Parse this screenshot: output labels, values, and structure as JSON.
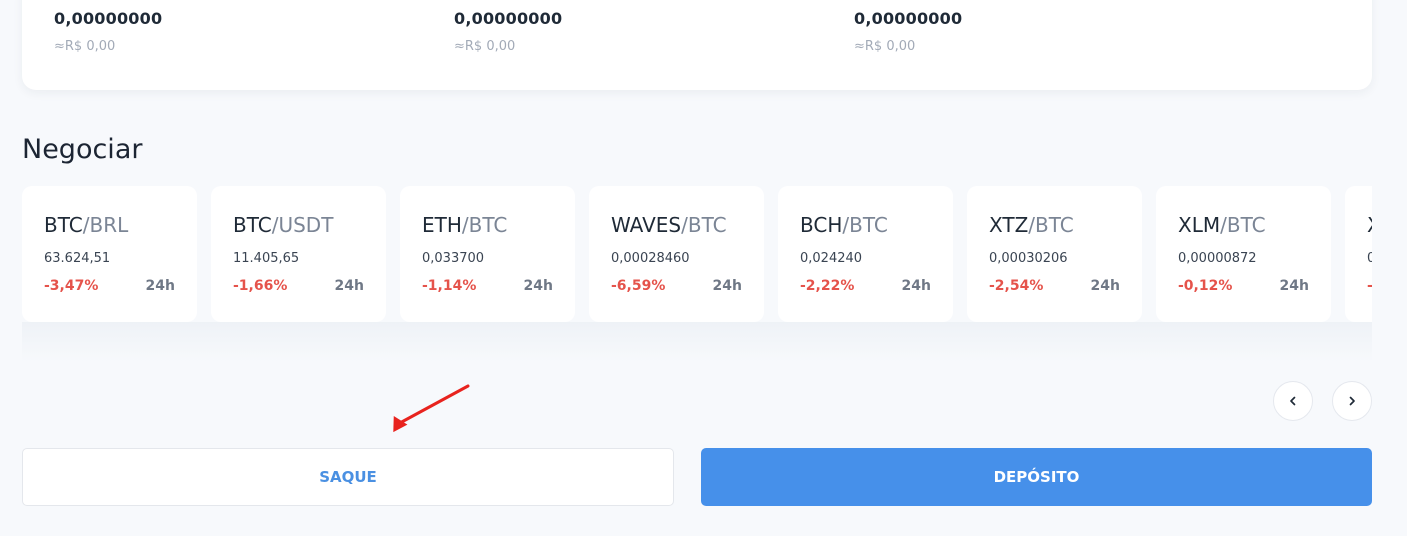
{
  "balances": [
    {
      "amount": "0,00000000",
      "fiat": "≈R$ 0,00"
    },
    {
      "amount": "0,00000000",
      "fiat": "≈R$ 0,00"
    },
    {
      "amount": "0,00000000",
      "fiat": "≈R$ 0,00"
    }
  ],
  "trade": {
    "title": "Negociar",
    "markets": [
      {
        "base": "BTC",
        "quote": "/BRL",
        "price": "63.624,51",
        "change": "-3,47%",
        "period": "24h"
      },
      {
        "base": "BTC",
        "quote": "/USDT",
        "price": "11.405,65",
        "change": "-1,66%",
        "period": "24h"
      },
      {
        "base": "ETH",
        "quote": "/BTC",
        "price": "0,033700",
        "change": "-1,14%",
        "period": "24h"
      },
      {
        "base": "WAVES",
        "quote": "/BTC",
        "price": "0,00028460",
        "change": "-6,59%",
        "period": "24h"
      },
      {
        "base": "BCH",
        "quote": "/BTC",
        "price": "0,024240",
        "change": "-2,22%",
        "period": "24h"
      },
      {
        "base": "XTZ",
        "quote": "/BTC",
        "price": "0,00030206",
        "change": "-2,54%",
        "period": "24h"
      },
      {
        "base": "XLM",
        "quote": "/BTC",
        "price": "0,00000872",
        "change": "-0,12%",
        "period": "24h"
      },
      {
        "base": "X",
        "quote": "",
        "price": "0",
        "change": "-",
        "period": ""
      }
    ],
    "nav": {
      "prev_icon": "chevron-left-icon",
      "next_icon": "chevron-right-icon"
    }
  },
  "actions": {
    "withdraw_label": "SAQUE",
    "deposit_label": "DEPÓSITO"
  },
  "colors": {
    "accent": "#4690ea",
    "negative": "#e5534b",
    "annotation": "#e8231e"
  }
}
